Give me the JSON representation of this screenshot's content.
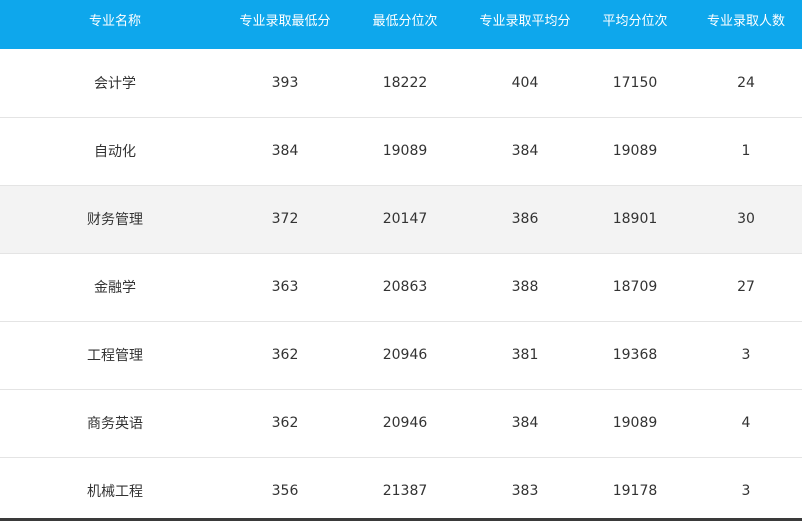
{
  "headers": [
    "专业名称",
    "专业录取最低分",
    "最低分位次",
    "专业录取平均分",
    "平均分位次",
    "专业录取人数"
  ],
  "rows": [
    [
      "会计学",
      "393",
      "18222",
      "404",
      "17150",
      "24"
    ],
    [
      "自动化",
      "384",
      "19089",
      "384",
      "19089",
      "1"
    ],
    [
      "财务管理",
      "372",
      "20147",
      "386",
      "18901",
      "30"
    ],
    [
      "金融学",
      "363",
      "20863",
      "388",
      "18709",
      "27"
    ],
    [
      "工程管理",
      "362",
      "20946",
      "381",
      "19368",
      "3"
    ],
    [
      "商务英语",
      "362",
      "20946",
      "384",
      "19089",
      "4"
    ],
    [
      "机械工程",
      "356",
      "21387",
      "383",
      "19178",
      "3"
    ]
  ],
  "colors": {
    "header_bg": "#0ea7ec",
    "header_text": "#ffffff",
    "highlight_row_bg": "#f3f3f3",
    "cell_text": "#333333"
  }
}
